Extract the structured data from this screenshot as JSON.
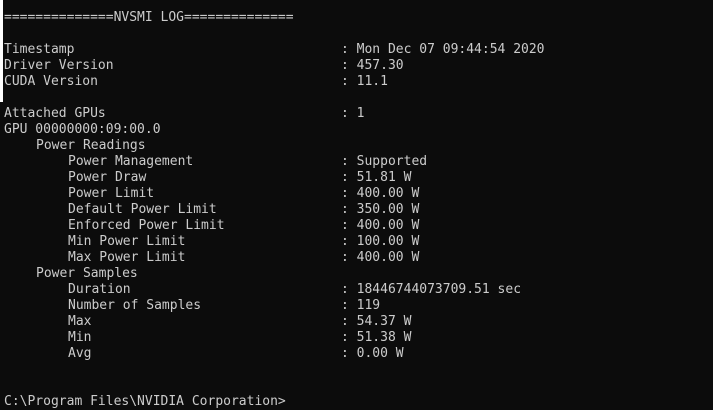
{
  "window": {
    "background": "#0c0c0c",
    "foreground": "#cccccc"
  },
  "header": "==============NVSMI LOG==============",
  "separator": ": ",
  "info": {
    "timestamp": {
      "label": "Timestamp",
      "value": "Mon Dec 07 09:44:54 2020"
    },
    "driver_version": {
      "label": "Driver Version",
      "value": "457.30"
    },
    "cuda_version": {
      "label": "CUDA Version",
      "value": "11.1"
    }
  },
  "attached_gpus": {
    "label": "Attached GPUs",
    "value": "1"
  },
  "gpu": {
    "id": "GPU 00000000:09:00.0",
    "power_readings": {
      "title": "Power Readings",
      "rows": [
        {
          "label": "Power Management",
          "value": "Supported"
        },
        {
          "label": "Power Draw",
          "value": "51.81 W"
        },
        {
          "label": "Power Limit",
          "value": "400.00 W"
        },
        {
          "label": "Default Power Limit",
          "value": "350.00 W"
        },
        {
          "label": "Enforced Power Limit",
          "value": "400.00 W"
        },
        {
          "label": "Min Power Limit",
          "value": "100.00 W"
        },
        {
          "label": "Max Power Limit",
          "value": "400.00 W"
        }
      ]
    },
    "power_samples": {
      "title": "Power Samples",
      "rows": [
        {
          "label": "Duration",
          "value": "18446744073709.51 sec"
        },
        {
          "label": "Number of Samples",
          "value": "119"
        },
        {
          "label": "Max",
          "value": "54.37 W"
        },
        {
          "label": "Min",
          "value": "51.38 W"
        },
        {
          "label": "Avg",
          "value": "0.00 W"
        }
      ]
    }
  },
  "prompt": "C:\\Program Files\\NVIDIA Corporation>"
}
